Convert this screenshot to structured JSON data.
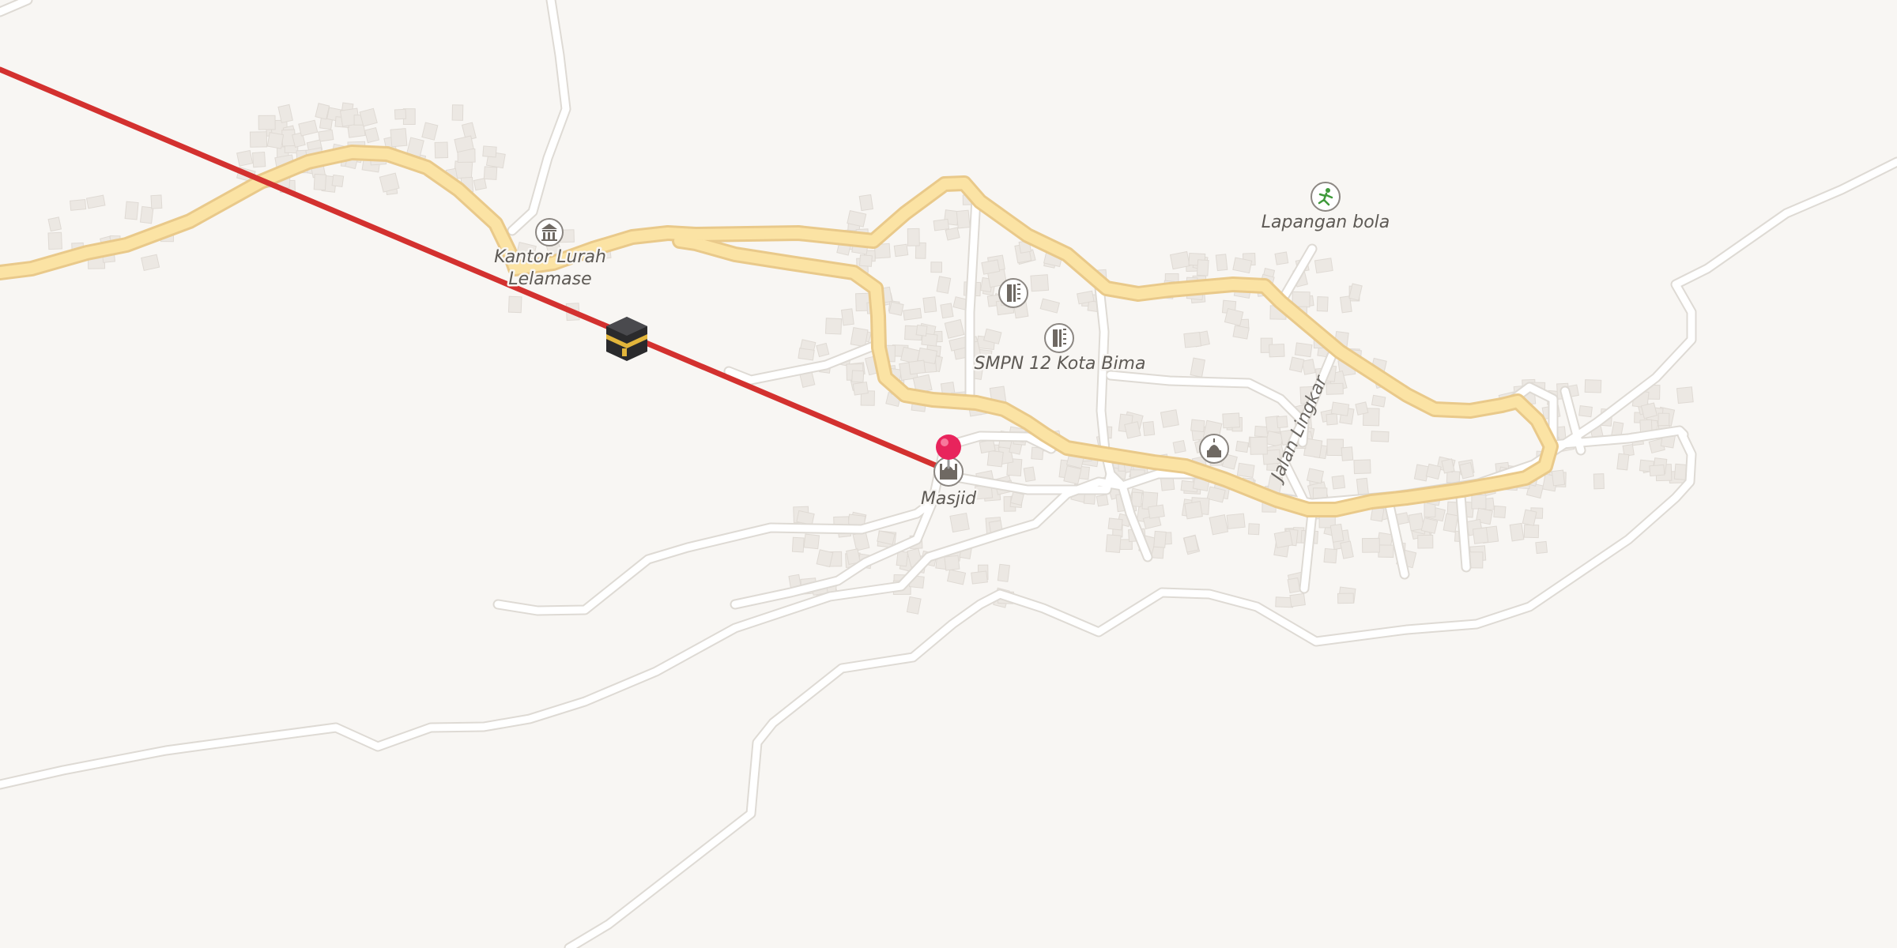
{
  "map": {
    "labels": {
      "kantor_line1": "Kantor Lurah",
      "kantor_line2": "Lelamase",
      "masjid": "Masjid",
      "smpn": "SMPN 12 Kota Bima",
      "lapangan": "Lapangan bola",
      "jalan": "Jalan Lingkar"
    },
    "icons": {
      "kantor": "town-hall-icon",
      "masjid": "mosque-icon",
      "school": "school-icon",
      "sports": "soccer-field-icon",
      "kaaba": "kaaba-icon",
      "pin": "location-pin-icon"
    },
    "colors": {
      "background": "#f8f6f3",
      "main_road": "#fbe3a4",
      "main_road_casing": "#e9c98a",
      "minor_road": "#ffffff",
      "minor_road_casing": "#dedad4",
      "qibla_line": "#d3312f",
      "pin": "#e8245c",
      "sports_icon": "#3f9a3a"
    }
  }
}
